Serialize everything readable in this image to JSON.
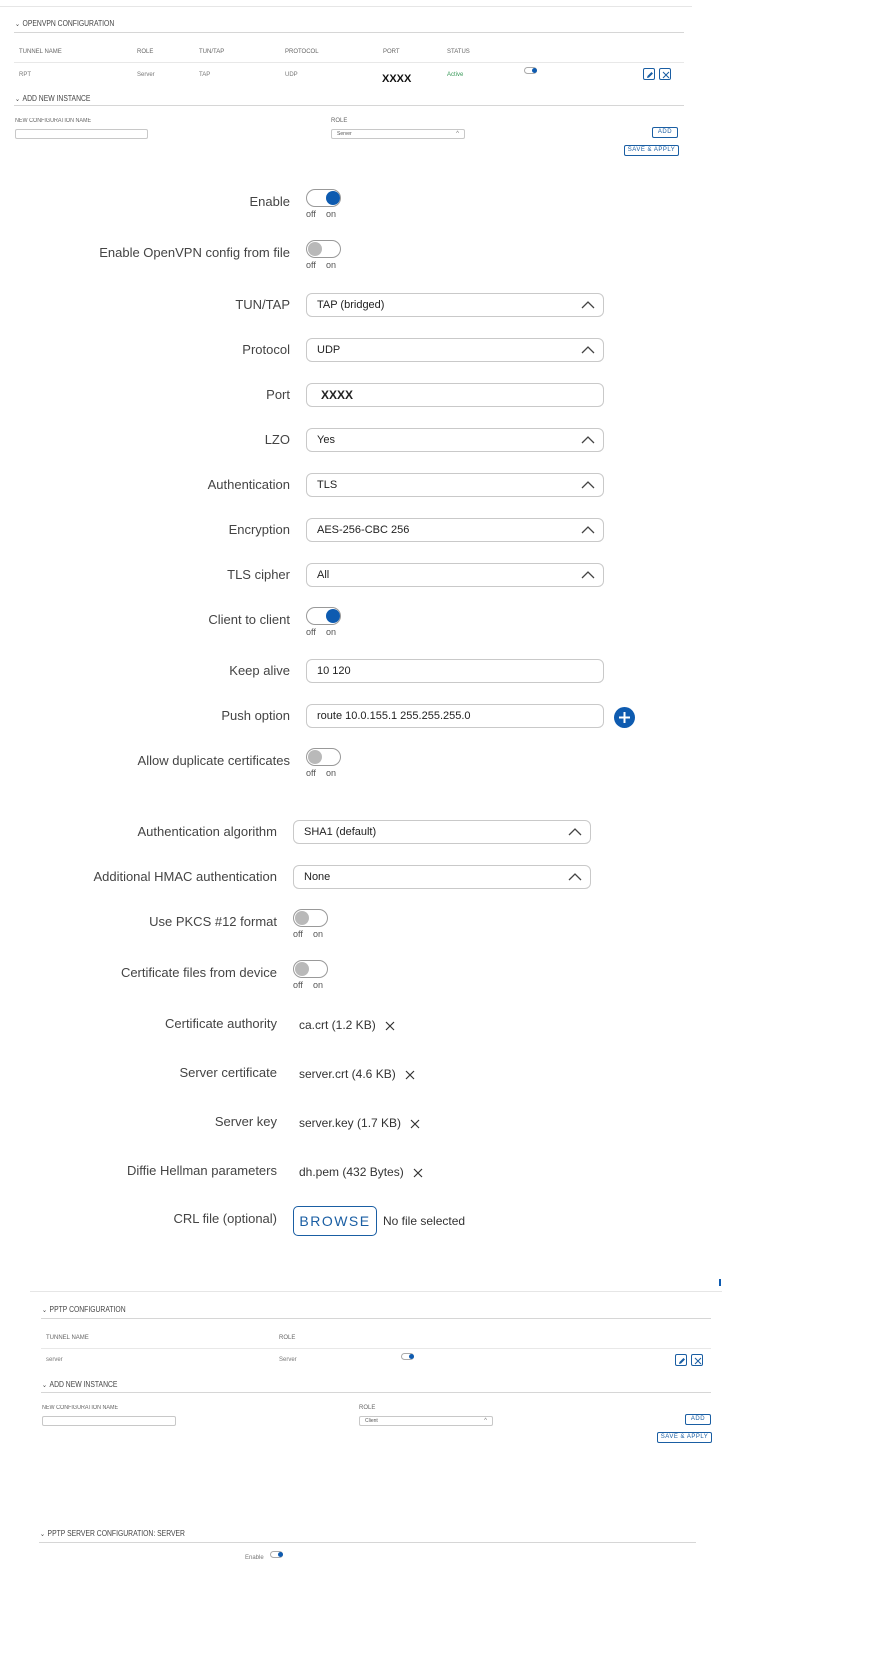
{
  "openvpn": {
    "section_title": "OPENVPN CONFIGURATION",
    "columns": [
      "TUNNEL NAME",
      "ROLE",
      "TUN/TAP",
      "PROTOCOL",
      "PORT",
      "STATUS"
    ],
    "row": {
      "name": "RPT",
      "role": "Server",
      "tuntap": "TAP",
      "protocol": "UDP",
      "port": "XXXX",
      "status": "Active"
    },
    "add_title": "ADD NEW INSTANCE",
    "new_config_label": "NEW CONFIGURATION NAME",
    "role_label": "ROLE",
    "role_value": "Server",
    "add_button": "ADD",
    "save_button": "SAVE & APPLY"
  },
  "form": {
    "enable_label": "Enable",
    "enable_file_label": "Enable OpenVPN config from file",
    "tuntap_label": "TUN/TAP",
    "tuntap_value": "TAP (bridged)",
    "protocol_label": "Protocol",
    "protocol_value": "UDP",
    "port_label": "Port",
    "port_value": "XXXX",
    "lzo_label": "LZO",
    "lzo_value": "Yes",
    "auth_label": "Authentication",
    "auth_value": "TLS",
    "enc_label": "Encryption",
    "enc_value": "AES-256-CBC 256",
    "tls_label": "TLS cipher",
    "tls_value": "All",
    "c2c_label": "Client to client",
    "keepalive_label": "Keep alive",
    "keepalive_value": "10 120",
    "push_label": "Push option",
    "push_value": "route 10.0.155.1 255.255.255.0",
    "dup_label": "Allow duplicate certificates",
    "auth_algo_label": "Authentication algorithm",
    "auth_algo_value": "SHA1 (default)",
    "hmac_label": "Additional HMAC authentication",
    "hmac_value": "None",
    "pkcs_label": "Use PKCS #12 format",
    "certdev_label": "Certificate files from device",
    "ca_label": "Certificate authority",
    "ca_value": "ca.crt (1.2 KB)",
    "servcert_label": "Server certificate",
    "servcert_value": "server.crt (4.6 KB)",
    "servkey_label": "Server key",
    "servkey_value": "server.key (1.7 KB)",
    "dh_label": "Diffie Hellman parameters",
    "dh_value": "dh.pem (432 Bytes)",
    "crl_label": "CRL file (optional)",
    "browse_label": "BROWSE",
    "no_file": "No file selected",
    "toggle_off": "off",
    "toggle_on": "on"
  },
  "pptp": {
    "section_title": "PPTP CONFIGURATION",
    "columns": [
      "TUNNEL NAME",
      "ROLE"
    ],
    "row": {
      "name": "server",
      "role": "Server"
    },
    "add_title": "ADD NEW INSTANCE",
    "new_config_label": "NEW CONFIGURATION NAME",
    "role_label": "ROLE",
    "role_value": "Client",
    "add_button": "ADD",
    "save_button": "SAVE & APPLY"
  },
  "pptp_server": {
    "section_title": "PPTP SERVER CONFIGURATION: SERVER",
    "enable_label": "Enable"
  },
  "colors": {
    "accent": "#0e5bb0",
    "active_status": "#3a9a5a"
  }
}
